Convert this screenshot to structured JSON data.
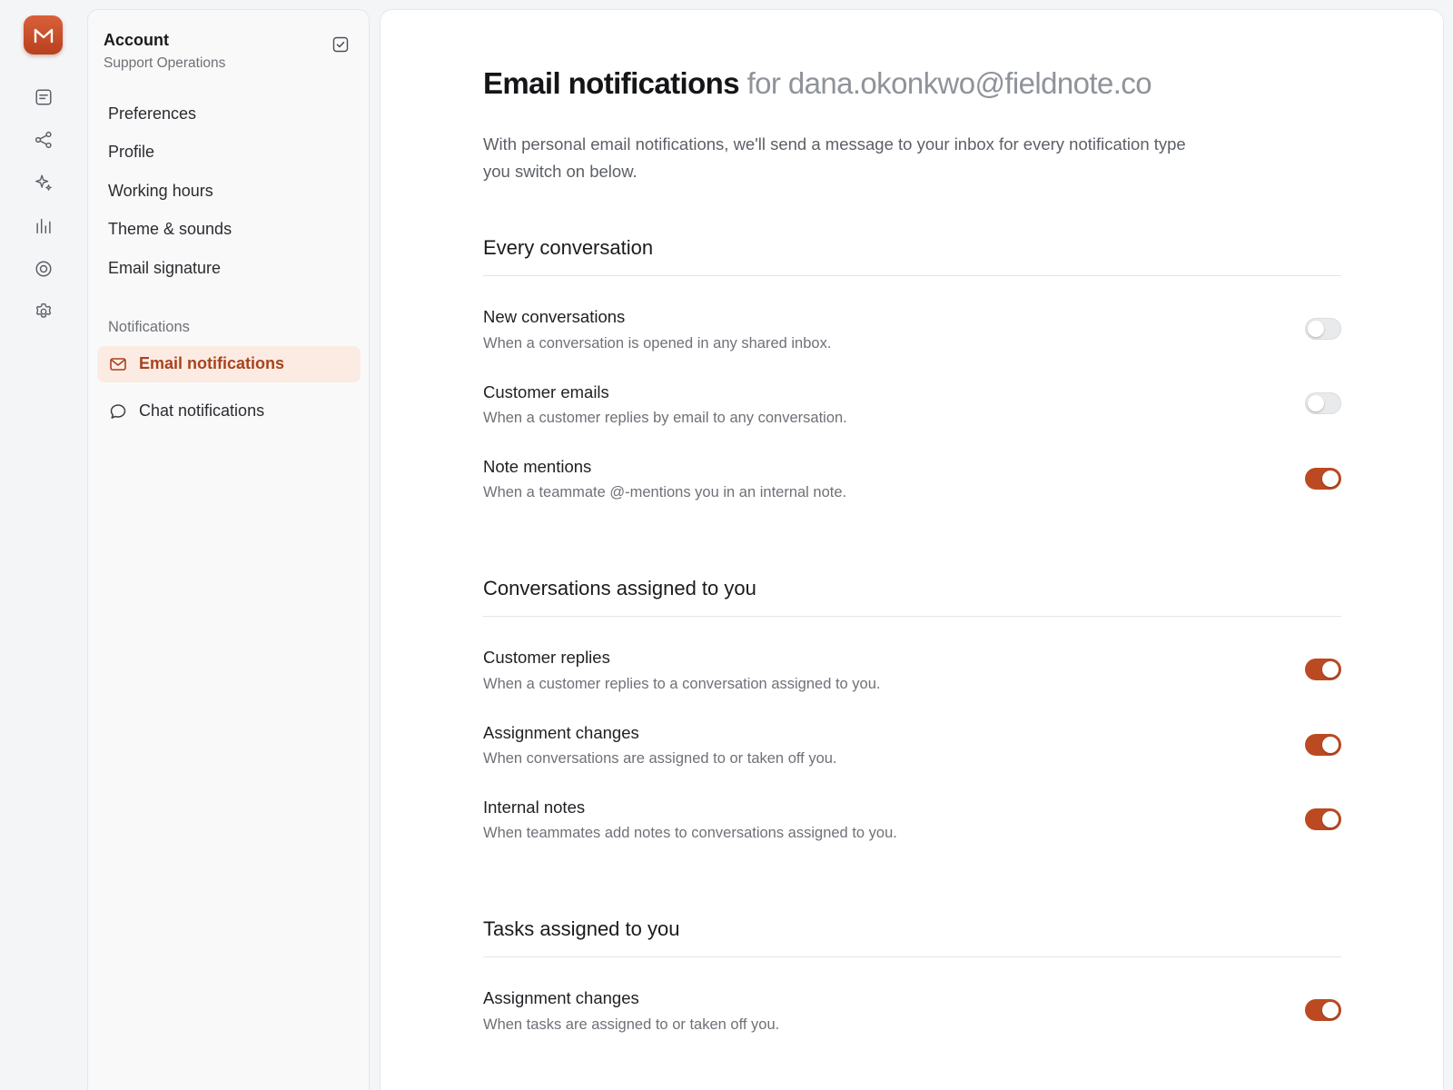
{
  "rail": {
    "logo_icon": "m-logo-icon",
    "items": [
      {
        "icon": "inbox-icon"
      },
      {
        "icon": "share-icon"
      },
      {
        "icon": "sparkles-icon"
      },
      {
        "icon": "bar-chart-icon"
      },
      {
        "icon": "target-icon"
      },
      {
        "icon": "gear-icon"
      }
    ]
  },
  "sidebar": {
    "title": "Account",
    "subtitle": "Support Operations",
    "items": [
      {
        "label": "Preferences"
      },
      {
        "label": "Profile"
      },
      {
        "label": "Working hours"
      },
      {
        "label": "Theme & sounds"
      },
      {
        "label": "Email signature"
      }
    ],
    "notifications_heading": "Notifications",
    "notif_items": [
      {
        "label": "Email notifications",
        "icon": "mail-icon",
        "active": true
      },
      {
        "label": "Chat notifications",
        "icon": "chat-bubble-icon",
        "active": false
      }
    ]
  },
  "main": {
    "title": "Email notifications",
    "title_email": "for dana.okonkwo@fieldnote.co",
    "intro": "With personal email notifications, we'll send a message to your inbox for every notification type you switch on below.",
    "sections": [
      {
        "title": "Every conversation",
        "rows": [
          {
            "title": "New conversations",
            "desc": "When a conversation is opened in any shared inbox.",
            "on": false
          },
          {
            "title": "Customer emails",
            "desc": "When a customer replies by email to any conversation.",
            "on": false
          },
          {
            "title": "Note mentions",
            "desc": "When a teammate @-mentions you in an internal note.",
            "on": true
          }
        ]
      },
      {
        "title": "Conversations assigned to you",
        "rows": [
          {
            "title": "Customer replies",
            "desc": "When a customer replies to a conversation assigned to you.",
            "on": true
          },
          {
            "title": "Assignment changes",
            "desc": "When conversations are assigned to or taken off you.",
            "on": true
          },
          {
            "title": "Internal notes",
            "desc": "When teammates add notes to conversations assigned to you.",
            "on": true
          }
        ]
      },
      {
        "title": "Tasks assigned to you",
        "rows": [
          {
            "title": "Assignment changes",
            "desc": "When tasks are assigned to or taken off you.",
            "on": true
          }
        ]
      }
    ]
  },
  "colors": {
    "accent": "#bb4a22",
    "active_bg": "#fcebe3",
    "active_text": "#a8431e"
  }
}
